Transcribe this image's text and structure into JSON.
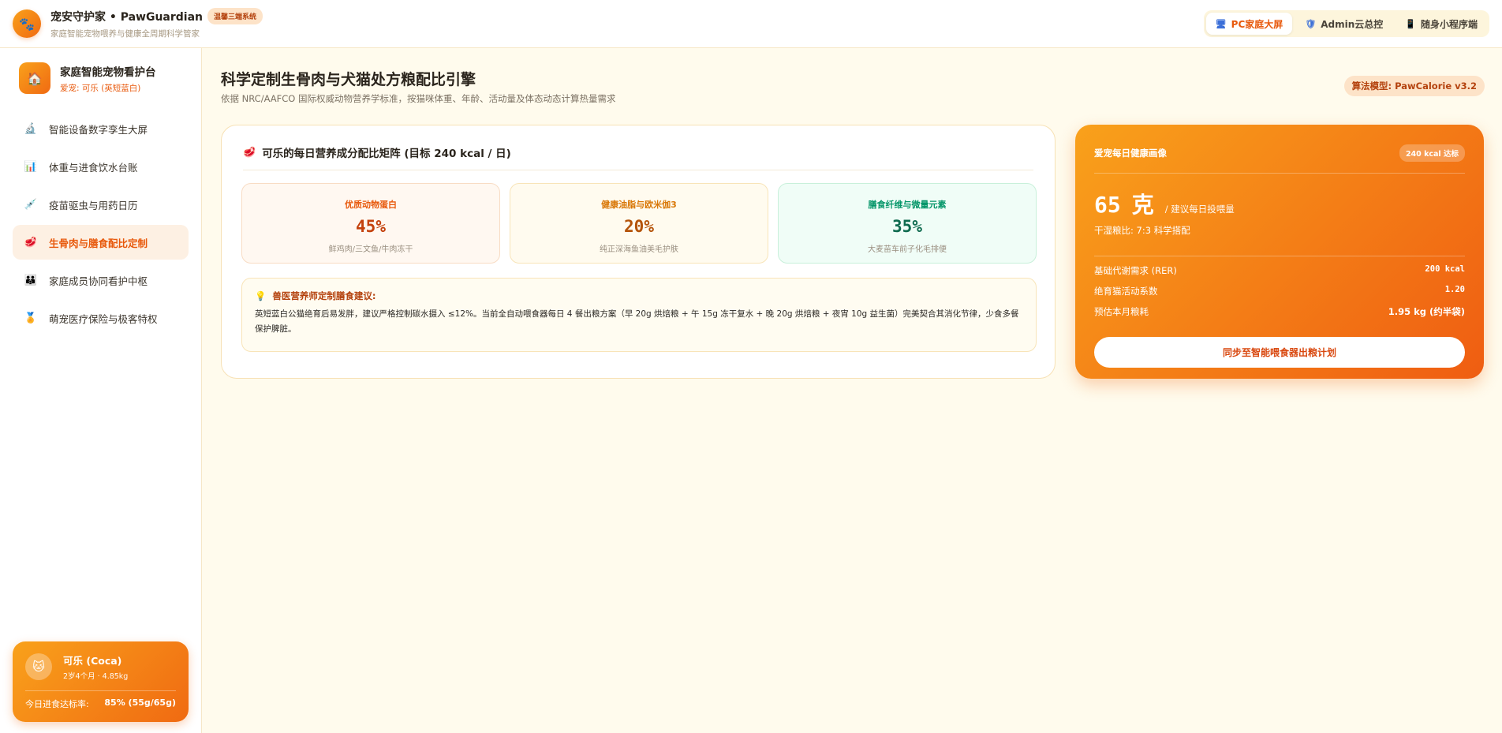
{
  "topbar": {
    "title": "宠安守护家 • PawGuardian",
    "tag": "温馨三端系统",
    "subtitle": "家庭智能宠物喂养与健康全周期科学管家",
    "modes": [
      {
        "label": "PC家庭大屏"
      },
      {
        "label": "Admin云总控"
      },
      {
        "label": "随身小程序端"
      }
    ]
  },
  "sidebar": {
    "title": "家庭智能宠物看护台",
    "subtitle": "爱宠: 可乐 (英短蓝白)",
    "items": [
      {
        "label": "智能设备数字孪生大屏"
      },
      {
        "label": "体重与进食饮水台账"
      },
      {
        "label": "疫苗驱虫与用药日历"
      },
      {
        "label": "生骨肉与膳食配比定制"
      },
      {
        "label": "家庭成员协同看护中枢"
      },
      {
        "label": "萌宠医疗保险与极客特权"
      }
    ],
    "pet": {
      "name": "可乐 (Coca)",
      "meta": "2岁4个月 · 4.85kg",
      "stat_label": "今日进食达标率:",
      "stat_value": "85% (55g/65g)"
    }
  },
  "main": {
    "title": "科学定制生骨肉与犬猫处方粮配比引擎",
    "subtitle": "依据 NRC/AAFCO 国际权威动物营养学标准，按猫咪体重、年龄、活动量及体态动态计算热量需求",
    "algo_badge": "算法模型: PawCalorie v3.2",
    "matrix": {
      "title": "可乐的每日营养成分配比矩阵 (目标 240 kcal / 日)",
      "metrics": [
        {
          "label": "优质动物蛋白",
          "value": "45%",
          "desc": "鲜鸡肉/三文鱼/牛肉冻干"
        },
        {
          "label": "健康油脂与欧米伽3",
          "value": "20%",
          "desc": "纯正深海鱼油美毛护肤"
        },
        {
          "label": "膳食纤维与微量元素",
          "value": "35%",
          "desc": "大麦苗车前子化毛排便"
        }
      ],
      "advice_title": "兽医营养师定制膳食建议:",
      "advice_text": "英短蓝白公猫绝育后易发胖，建议严格控制碳水摄入 ≤12%。当前全自动喂食器每日 4 餐出粮方案（早 20g 烘焙粮 + 午 15g 冻干复水 + 晚 20g 烘焙粮 + 夜宵 10g 益生菌）完美契合其消化节律，少食多餐保护脾脏。"
    },
    "profile": {
      "title": "爱宠每日健康画像",
      "badge": "240 kcal 达标",
      "amount": "65",
      "unit": "克",
      "hint": "/ 建议每日投喂量",
      "ratio": "干湿粮比: 7:3 科学搭配",
      "rows": [
        {
          "label": "基础代谢需求 (RER)",
          "value": "200 kcal"
        },
        {
          "label": "绝育猫活动系数",
          "value": "1.20"
        },
        {
          "label": "预估本月粮耗",
          "value": "1.95 kg (约半袋)"
        }
      ],
      "button": "同步至智能喂食器出粮计划"
    }
  }
}
